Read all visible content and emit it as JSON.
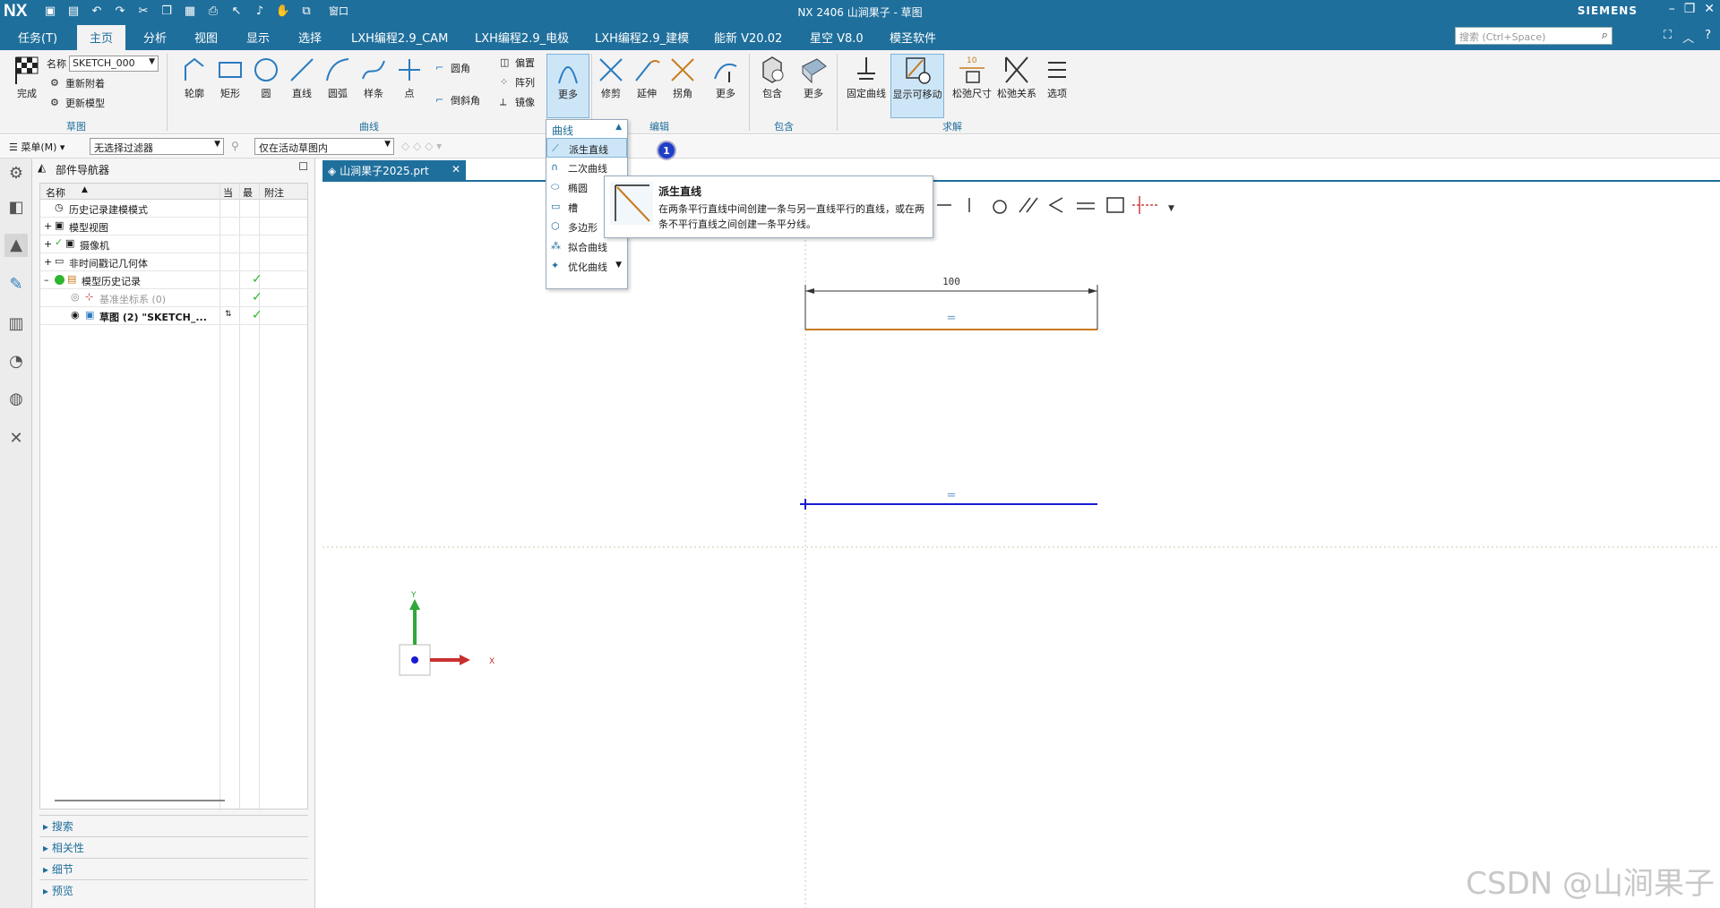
{
  "window": {
    "app_logo": "NX",
    "title": "NX 2406 山涧果子 - 草图",
    "brand": "SIEMENS",
    "quick_access_window": "窗口",
    "search_placeholder": "搜索 (Ctrl+Space)"
  },
  "menu_tabs": [
    "任务(T)",
    "主页",
    "分析",
    "视图",
    "显示",
    "选择",
    "LXH编程2.9_CAM",
    "LXH编程2.9_电极",
    "LXH编程2.9_建模",
    "能新 V20.02",
    "星空 V8.0",
    "模圣软件"
  ],
  "ribbon": {
    "finish_label": "完成",
    "name_label": "名称",
    "sketch_name": "SKETCH_000",
    "reattach_label": "重新附着",
    "update_model_label": "更新模型",
    "curve_buttons": [
      "轮廓",
      "矩形",
      "圆",
      "直线",
      "圆弧",
      "样条",
      "点"
    ],
    "fillet_label": "圆角",
    "chamfer_label": "倒斜角",
    "offset_label": "偏置",
    "pattern_label": "阵列",
    "mirror_label": "镜像",
    "more_label": "更多",
    "edit_buttons": [
      "修剪",
      "延伸",
      "拐角",
      "更多"
    ],
    "include_buttons": [
      "包含",
      "更多"
    ],
    "solve_buttons": [
      "固定曲线",
      "显示可移动",
      "松弛尺寸",
      "松弛关系",
      "选项"
    ],
    "groups": {
      "sketch": "草图",
      "curve": "曲线",
      "edit": "编辑",
      "include": "包含",
      "solve": "求解"
    }
  },
  "toolbar2": {
    "menu_label": "菜单(M)",
    "filter_value": "无选择过滤器",
    "scope_value": "仅在活动草图内"
  },
  "navigator": {
    "title": "部件导航器",
    "col_name": "名称",
    "col_current": "当",
    "col_latest": "最",
    "col_note": "附注",
    "rows": [
      {
        "label": "历史记录建模模式"
      },
      {
        "label": "模型视图"
      },
      {
        "label": "摄像机"
      },
      {
        "label": "非时间戳记几何体"
      },
      {
        "label": "模型历史记录"
      },
      {
        "label": "基准坐标系 (0)"
      },
      {
        "label": "草图 (2) \"SKETCH_..."
      }
    ],
    "sections": [
      "搜索",
      "相关性",
      "细节",
      "预览"
    ]
  },
  "doc_tab": "山涧果子2025.prt",
  "dropdown": {
    "header": "曲线",
    "items": [
      "派生直线",
      "二次曲线",
      "椭圆",
      "槽",
      "多边形",
      "拟合曲线",
      "优化曲线"
    ]
  },
  "tooltip": {
    "title": "派生直线",
    "desc": "在两条平行直线中间创建一条与另一直线平行的直线，或在两条不平行直线之间创建一条平分线。"
  },
  "badge": "1",
  "dimension": "100",
  "axis": {
    "x": "X",
    "y": "Y"
  },
  "watermark": "CSDN @山涧果子",
  "colors": {
    "accent": "#1f6f9c",
    "blue_line": "#1a1ad4",
    "orange_line": "#c87a1e",
    "check": "#2fb52f"
  }
}
